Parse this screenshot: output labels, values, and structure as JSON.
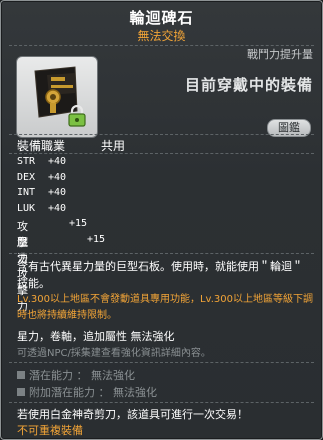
{
  "item": {
    "name": "輪迴碑石",
    "trade": "無法交換"
  },
  "compare": {
    "power_label": "戰鬥力提升量",
    "equipped_text": "目前穿戴中的裝備",
    "guide_button": "圖鑑"
  },
  "job": {
    "label": "裝備職業",
    "value": "共用"
  },
  "stats": [
    {
      "key": "STR",
      "value": "+40"
    },
    {
      "key": "DEX",
      "value": "+40"
    },
    {
      "key": "INT",
      "value": "+40"
    },
    {
      "key": "LUK",
      "value": "+40"
    },
    {
      "key": "攻擊力",
      "value": "+15"
    },
    {
      "key": "魔法攻擊力",
      "value": "+15"
    }
  ],
  "description": "含有古代異星力量的巨型石板。使用時，就能使用＂輪迴＂技能。",
  "warning": "Lv.300以上地區不會發動道具專用功能，Lv.300以上地區等級下調時也將持續維持限制。",
  "properties": "星力，卷軸，追加屬性 無法強化",
  "hint": "可透過NPC/採集建查看強化資訊詳細內容。",
  "potential": {
    "potential_line": "潛在能力 ： 無法強化",
    "additional_line": "附加潛在能力 ： 無法強化"
  },
  "footer": {
    "scissors": "若使用白金神奇剪刀，該道具可進行一次交易！",
    "no_duplicate": "不可重複裝備"
  },
  "colors": {
    "accent_orange": "#f2a437",
    "muted_gray": "#8a9093",
    "lock_green": "#7bc043"
  },
  "icons": [
    "lock-icon",
    "samsara-stone-icon"
  ]
}
